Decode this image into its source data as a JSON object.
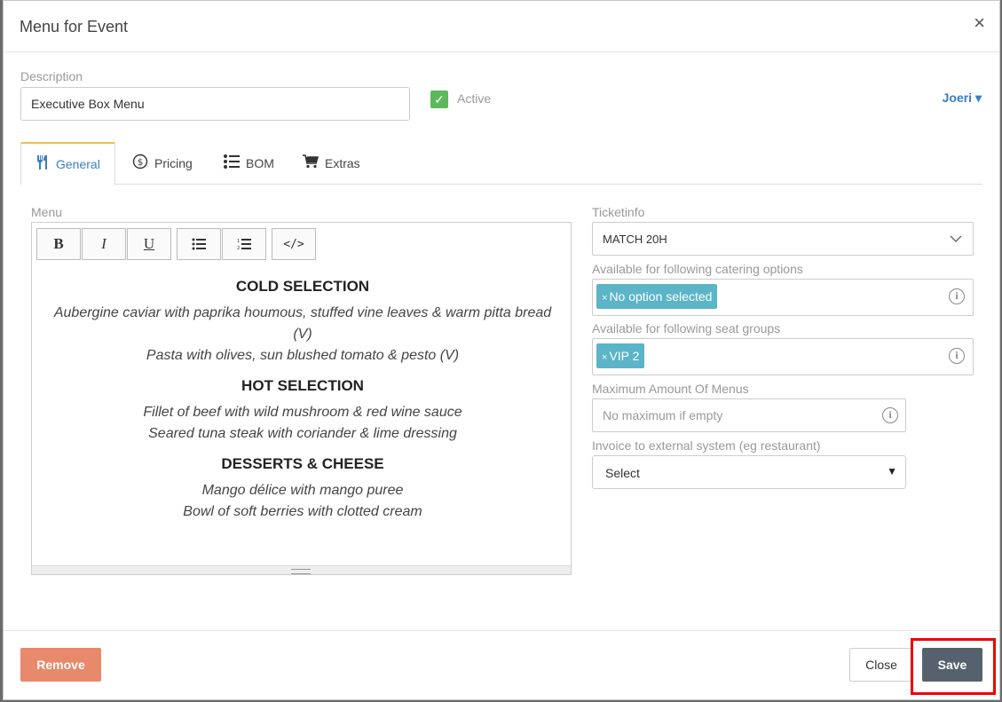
{
  "modal": {
    "title": "Menu for Event",
    "close_glyph": "×"
  },
  "description": {
    "label": "Description",
    "value": "Executive Box Menu"
  },
  "active": {
    "label": "Active",
    "checked": true
  },
  "user": {
    "name": "Joeri"
  },
  "tabs": [
    {
      "label": "General",
      "icon": "cutlery-icon",
      "active": true
    },
    {
      "label": "Pricing",
      "icon": "dollar-circle-icon"
    },
    {
      "label": "BOM",
      "icon": "list-icon"
    },
    {
      "label": "Extras",
      "icon": "cart-icon"
    }
  ],
  "menu": {
    "label": "Menu",
    "toolbar": [
      "B",
      "I",
      "U",
      "bullet-list",
      "numbered-list",
      "</>"
    ],
    "sections": [
      {
        "heading": "COLD SELECTION",
        "lines": [
          "Aubergine caviar with paprika houmous, stuffed vine leaves & warm pitta bread (V)",
          "Pasta with olives, sun blushed tomato & pesto (V)"
        ]
      },
      {
        "heading": "HOT SELECTION",
        "lines": [
          "Fillet of beef with wild mushroom & red wine sauce",
          "Seared tuna steak with coriander & lime dressing"
        ]
      },
      {
        "heading": "DESSERTS & CHEESE",
        "lines": [
          "Mango délice with mango puree",
          "Bowl of soft berries with clotted cream"
        ]
      }
    ]
  },
  "ticketinfo": {
    "label": "Ticketinfo",
    "value": "MATCH 20H"
  },
  "catering": {
    "label": "Available for following catering options",
    "tag": "No option selected"
  },
  "seatgroups": {
    "label": "Available for following seat groups",
    "tag": "VIP 2"
  },
  "max_menus": {
    "label": "Maximum Amount Of Menus",
    "placeholder": "No maximum if empty"
  },
  "invoice": {
    "label": "Invoice to external system (eg restaurant)",
    "value": "Select"
  },
  "footer": {
    "remove": "Remove",
    "close": "Close",
    "save": "Save"
  },
  "colors": {
    "accent": "#3a7fc1",
    "remove": "#e8896b",
    "save": "#55626d",
    "tag": "#5bb4c8",
    "highlight": "#e00000"
  }
}
